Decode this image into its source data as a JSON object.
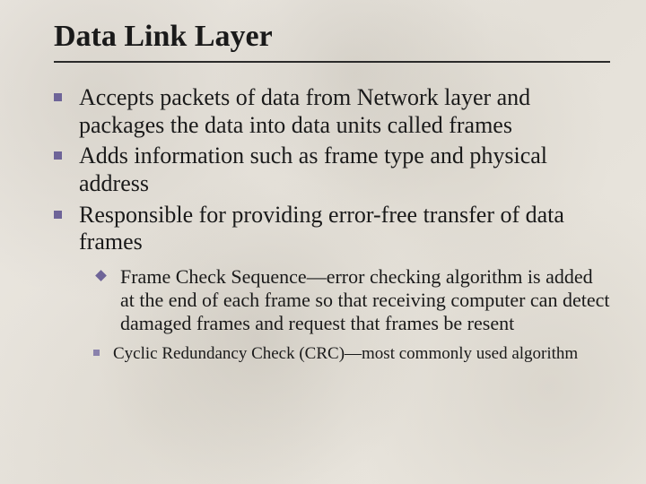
{
  "title": "Data Link Layer",
  "bullets": {
    "b1": "Accepts packets of data from Network layer and packages the data into data units called frames",
    "b2": "Adds information such as frame type and physical address",
    "b3": "Responsible for providing error-free transfer of data frames"
  },
  "sub1": "Frame Check Sequence—error checking algorithm is added at the end of each frame so that receiving computer can detect damaged frames and request that frames be resent",
  "sub2": "Cyclic Redundancy Check (CRC)—most commonly used algorithm"
}
